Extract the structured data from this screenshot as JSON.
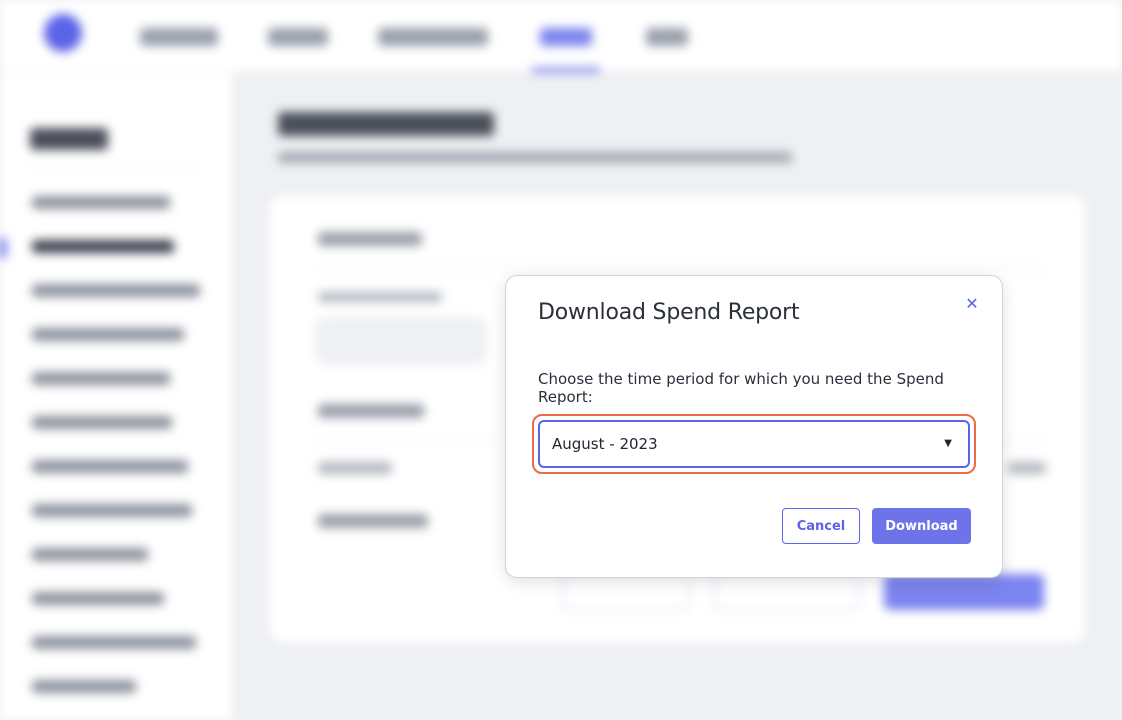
{
  "modal": {
    "title": "Download Spend Report",
    "close_icon": "close-icon",
    "description": "Choose the time period for which you need the Spend Report:",
    "period_select": {
      "value": "August - 2023",
      "caret_icon": "caret-down-icon"
    },
    "cancel_label": "Cancel",
    "download_label": "Download"
  },
  "colors": {
    "accent": "#5b63e8",
    "primary_button": "#6e73ea",
    "focus_outline": "#ee6a44",
    "title_text": "#2a2f3a"
  }
}
